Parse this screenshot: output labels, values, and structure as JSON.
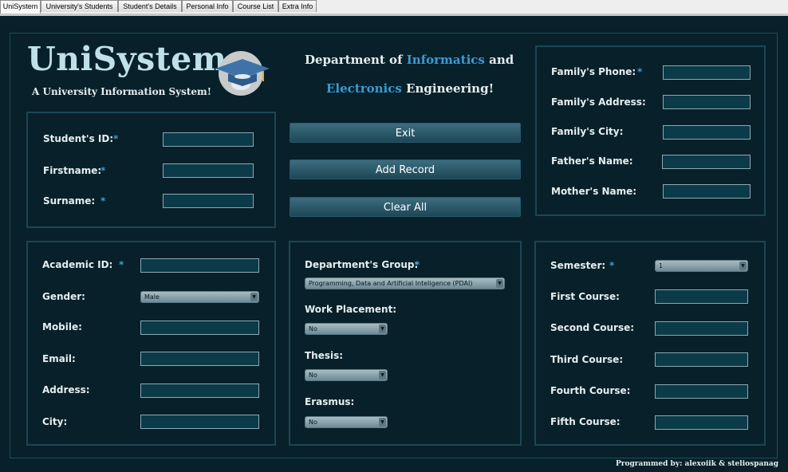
{
  "tabs": [
    "UniSystem",
    "University's Students",
    "Student's Details",
    "Personal Info",
    "Course List",
    "Extra Info"
  ],
  "header": {
    "title": "UniSystem",
    "subtitle": "A University Information System!",
    "dept_line1_a": "Department of",
    "dept_line1_b": "Informatics",
    "dept_line1_c": "and",
    "dept_line2_a": "Electronics",
    "dept_line2_b": "Engineering!"
  },
  "required_mark": "*",
  "student": {
    "id_label": "Student's ID:",
    "firstname_label": "Firstname:",
    "surname_label": "Surname:"
  },
  "buttons": {
    "exit": "Exit",
    "add": "Add Record",
    "clear": "Clear All"
  },
  "family": {
    "phone_label": "Family's Phone:",
    "address_label": "Family's Address:",
    "city_label": "Family's City:",
    "father_label": "Father's Name:",
    "mother_label": "Mother's Name:"
  },
  "personal": {
    "academic_id_label": "Academic ID:",
    "gender_label": "Gender:",
    "gender_value": "Male",
    "mobile_label": "Mobile:",
    "email_label": "Email:",
    "address_label": "Address:",
    "city_label": "City:"
  },
  "dept_group": {
    "group_label": "Department's Group:",
    "group_value": "Programming, Data and Artificial Inteligence (PDAI)",
    "work_label": "Work Placement:",
    "work_value": "No",
    "thesis_label": "Thesis:",
    "thesis_value": "No",
    "erasmus_label": "Erasmus:",
    "erasmus_value": "No"
  },
  "courses": {
    "semester_label": "Semester:",
    "semester_value": "1",
    "first_label": "First Course:",
    "second_label": "Second Course:",
    "third_label": "Third Course:",
    "fourth_label": "Fourth Course:",
    "fifth_label": "Fifth Course:"
  },
  "footer": "Programmed by: alexoiik & steliospanag",
  "colors": {
    "background": "#082029",
    "accent": "#3a9bd4",
    "field": "#0b3a48",
    "panel_border": "#1a4755"
  },
  "icons": {
    "logo": "graduation-cap-icon",
    "dropdown": "chevron-down-icon"
  }
}
